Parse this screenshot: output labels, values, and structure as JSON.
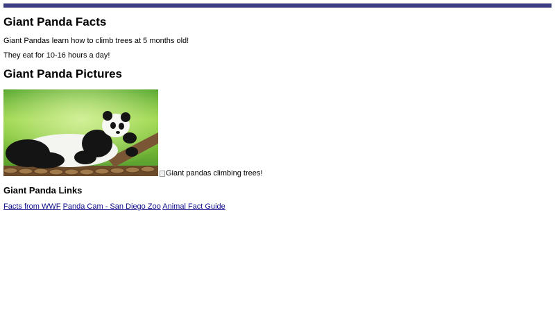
{
  "colors": {
    "top_bar": "#3f3d82",
    "link": "#0b0b8b"
  },
  "facts_section": {
    "heading": "Giant Panda Facts",
    "facts": [
      "Giant Pandas learn how to climb trees at 5 months old!",
      "They eat for 10-16 hours a day!"
    ]
  },
  "pictures_section": {
    "heading": "Giant Panda Pictures",
    "images": [
      {
        "icon": "panda-photo"
      },
      {
        "alt": "Giant pandas climbing trees!",
        "icon": "broken-image-icon"
      }
    ]
  },
  "links_section": {
    "heading": "Giant Panda Links",
    "links": [
      {
        "label": "Facts from WWF"
      },
      {
        "label": "Panda Cam - San Diego Zoo"
      },
      {
        "label": "Animal Fact Guide"
      }
    ]
  }
}
